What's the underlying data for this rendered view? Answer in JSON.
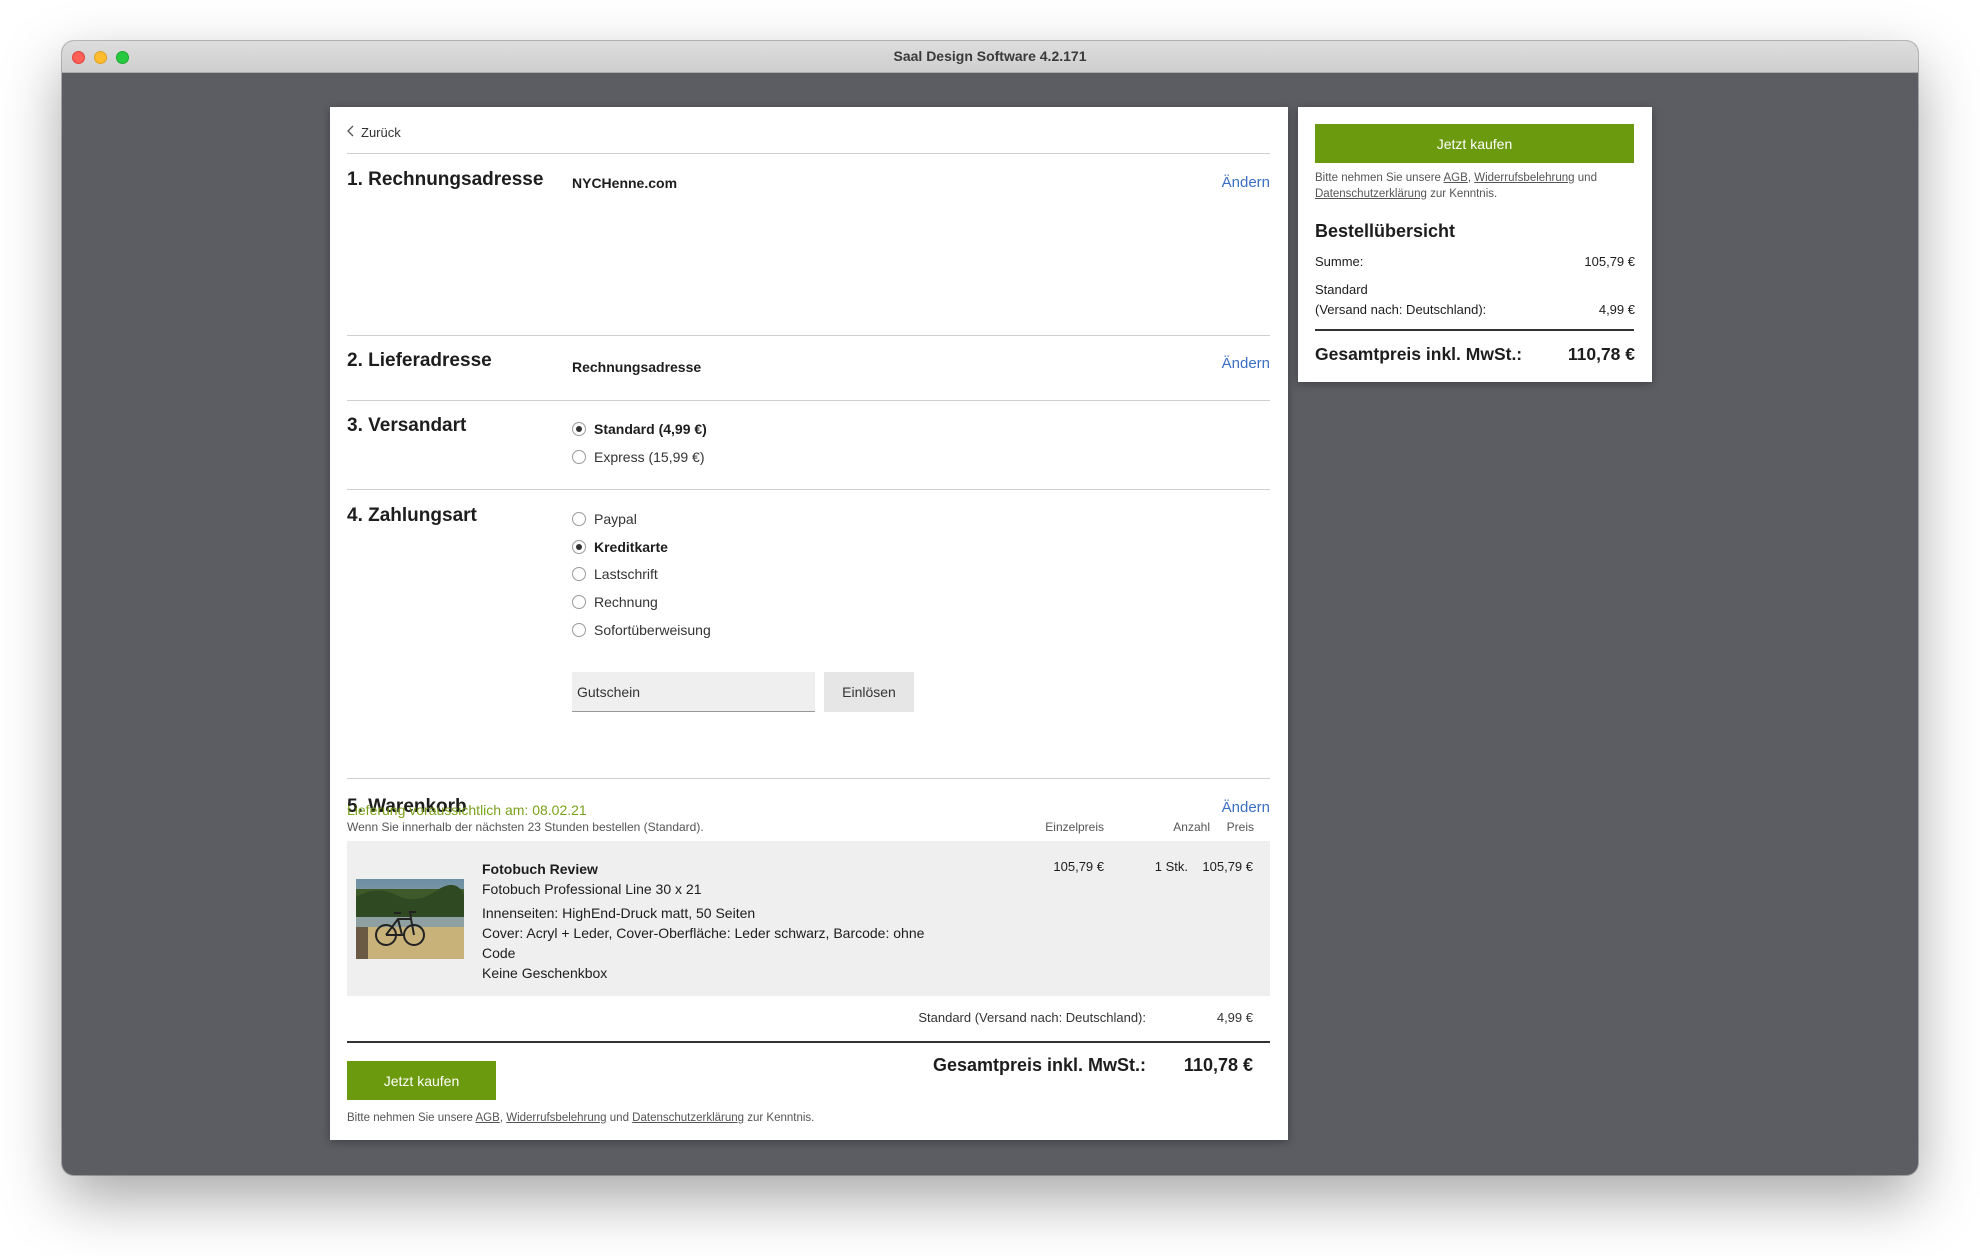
{
  "window": {
    "title": "Saal Design Software 4.2.171"
  },
  "main": {
    "back_label": "Zurück",
    "change_label": "Ändern",
    "billing": {
      "title": "1. Rechnungsadresse",
      "value": "NYCHenne.com"
    },
    "shipping": {
      "title": "2. Lieferadresse",
      "value": "Rechnungsadresse"
    },
    "shipping_method": {
      "title": "3. Versandart",
      "options": [
        {
          "label": "Standard (4,99 €)",
          "checked": true
        },
        {
          "label": "Express (15,99 €)",
          "checked": false
        }
      ]
    },
    "payment": {
      "title": "4. Zahlungsart",
      "options": [
        {
          "label": "Paypal",
          "checked": false
        },
        {
          "label": "Kreditkarte",
          "checked": true
        },
        {
          "label": "Lastschrift",
          "checked": false
        },
        {
          "label": "Rechnung",
          "checked": false
        },
        {
          "label": "Sofortüberweisung",
          "checked": false
        }
      ],
      "voucher_placeholder": "Gutschein",
      "redeem_label": "Einlösen"
    },
    "cart": {
      "title": "5. Warenkorb",
      "delivery_estimate": "Lieferung voraussichtlich am: 08.02.21",
      "delivery_note": "Wenn Sie innerhalb der nächsten 23 Stunden bestellen (Standard).",
      "columns": {
        "unit_price": "Einzelpreis",
        "quantity": "Anzahl",
        "price": "Preis"
      },
      "item": {
        "name": "Fotobuch Review",
        "product": "Fotobuch Professional Line 30 x 21",
        "pages": "Innenseiten: HighEnd-Druck matt, 50 Seiten",
        "cover": "Cover: Acryl + Leder, Cover-Oberfläche: Leder schwarz, Barcode: ohne Code",
        "giftbox": "Keine Geschenkbox",
        "unit_price": "105,79 €",
        "quantity": "1 Stk.",
        "price": "105,79 €"
      },
      "shipping_label": "Standard (Versand nach: Deutschland):",
      "shipping_price": "4,99 €",
      "total_label": "Gesamtpreis inkl. MwSt.:",
      "total_value": "110,78 €"
    },
    "buy_label": "Jetzt kaufen",
    "legal": {
      "prefix": "Bitte nehmen Sie unsere",
      "agb": "AGB",
      "comma": ",",
      "widerruf": "Widerrufsbelehrung",
      "and": "und",
      "datenschutz": "Datenschutzerklärung",
      "suffix": "zur Kenntnis."
    }
  },
  "summary": {
    "buy_label": "Jetzt kaufen",
    "title": "Bestellübersicht",
    "sum_label": "Summe:",
    "sum_value": "105,79 €",
    "shipping_label_1": "Standard",
    "shipping_label_2": "(Versand nach: Deutschland):",
    "shipping_value": "4,99 €",
    "total_label": "Gesamtpreis inkl. MwSt.:",
    "total_value": "110,78 €"
  },
  "colors": {
    "accent_green": "#6c9a0e",
    "link_blue": "#3a6fc4",
    "delivery_green": "#7aa11b",
    "window_bg": "#5b5d63"
  }
}
